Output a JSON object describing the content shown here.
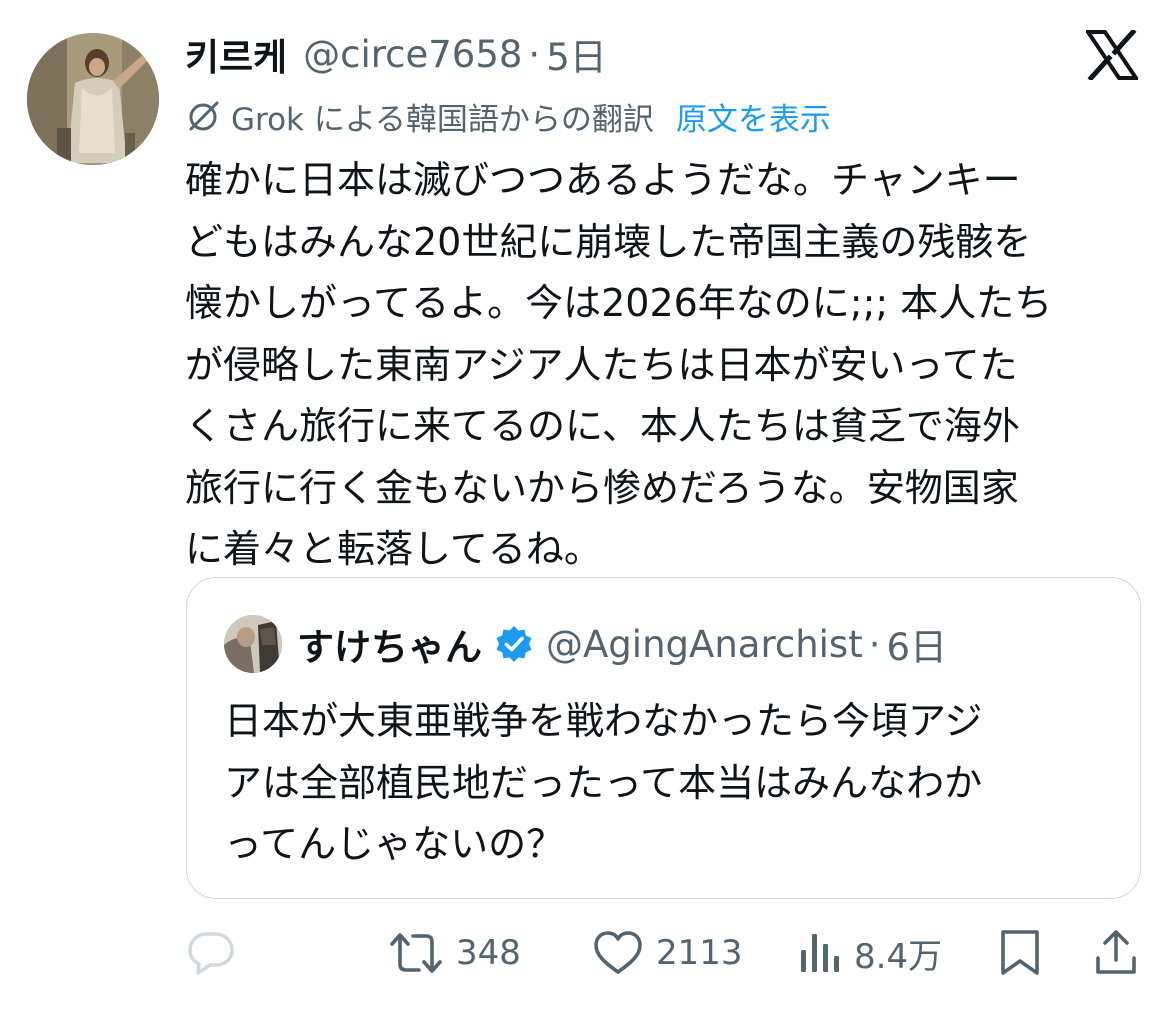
{
  "author": {
    "name": "키르케",
    "handle": "@circe7658",
    "separator": "·",
    "time": "5日"
  },
  "translation": {
    "label": "Grok による韓国語からの翻訳",
    "show_original": "原文を表示"
  },
  "tweet_lines": [
    "確かに日本は滅びつつあるようだな。チャンキー",
    "どもはみんな20世紀に崩壊した帝国主義の残骸を",
    "懐かしがってるよ。今は2026年なのに;;; 本人たち",
    "が侵略した東南アジア人たちは日本が安いってた",
    "くさん旅行に来てるのに、本人たちは貧乏で海外",
    "旅行に行く金もないから惨めだろうな。安物国家",
    "に着々と転落してるね。"
  ],
  "quote": {
    "name": "すけちゃん",
    "handle": "@AgingAnarchist",
    "separator": "·",
    "time": "6日",
    "lines": [
      "日本が大東亜戦争を戦わなかったら今頃アジ",
      "アは全部植民地だったって本当はみんなわか",
      "ってんじゃないの？"
    ]
  },
  "actions": {
    "reply_icon": "reply-icon",
    "retweet_icon": "retweet-icon",
    "retweets": "348",
    "like_icon": "heart-icon",
    "likes": "2113",
    "views_icon": "views-icon",
    "views": "8.4万",
    "bookmark_icon": "bookmark-icon",
    "share_icon": "share-icon"
  },
  "colors": {
    "text": "#0f1419",
    "secondary": "#536471",
    "link": "#1d9bf0",
    "verified": "#1d9bf0",
    "border": "#cfd9de"
  }
}
